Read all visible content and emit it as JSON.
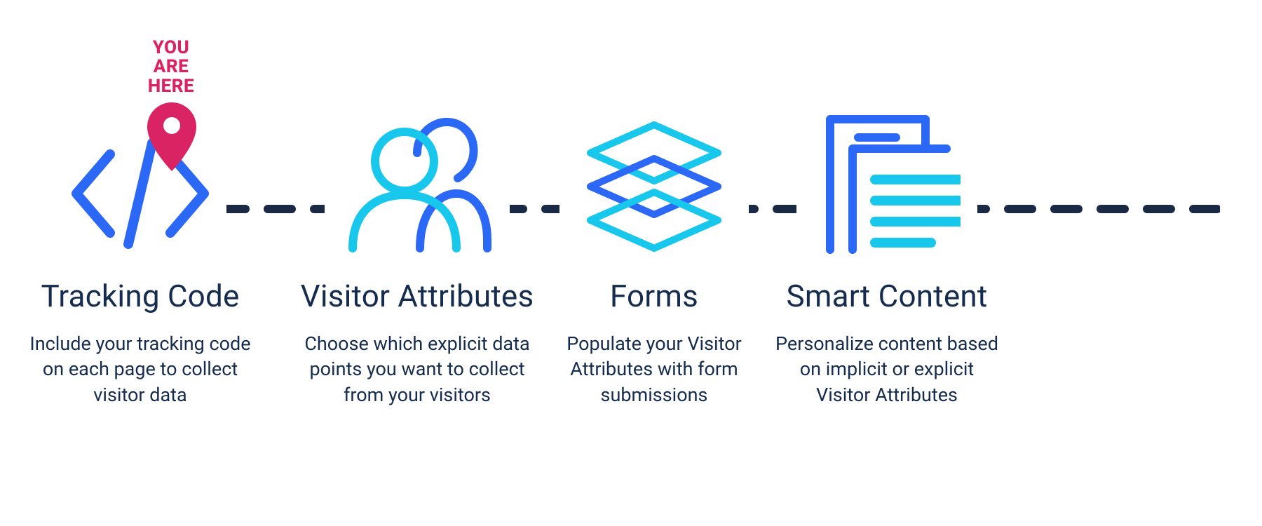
{
  "marker": {
    "line1": "YOU",
    "line2": "ARE",
    "line3": "HERE"
  },
  "steps": [
    {
      "title": "Tracking Code",
      "desc": "Include your tracking code on each page to collect visitor data"
    },
    {
      "title": "Visitor Attributes",
      "desc": "Choose which explicit data points you want to collect from your visitors"
    },
    {
      "title": "Forms",
      "desc": "Populate your Visitor Attributes with form submissions"
    },
    {
      "title": "Smart Content",
      "desc": "Personalize content based on implicit or explicit Visitor Attributes"
    }
  ],
  "colors": {
    "brand_blue": "#2c68f6",
    "brand_cyan": "#18c7ec",
    "text_navy": "#162c4e",
    "dash_navy": "#1a2a44",
    "marker_pink": "#d92362"
  }
}
